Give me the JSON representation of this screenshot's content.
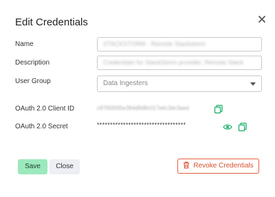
{
  "dialog": {
    "title": "Edit Credentials",
    "close_icon": "close-icon"
  },
  "form": {
    "name_label": "Name",
    "name_value": "STACKSTORM - Remote Stackstorm",
    "description_label": "Description",
    "description_value": "Credentials for StackStorm provider: Remote Stack",
    "user_group_label": "User Group",
    "user_group_placeholder": "Data Ingesters",
    "client_id_label": "OAuth 2.0 Client ID",
    "client_id_value": "c8765f005e394d8d8c017e6c3dc3aed",
    "secret_label": "OAuth 2.0 Secret",
    "secret_value": "**********************************"
  },
  "icons": {
    "copy": "copy-icon",
    "show": "eye-icon",
    "dropdown": "chevron-down-icon",
    "trash": "trash-icon"
  },
  "actions": {
    "save_label": "Save",
    "close_label": "Close",
    "revoke_label": "Revoke Credentials"
  },
  "colors": {
    "accent_green": "#2bb673",
    "save_bg": "#9ce9bd",
    "revoke": "#e55b3c"
  }
}
